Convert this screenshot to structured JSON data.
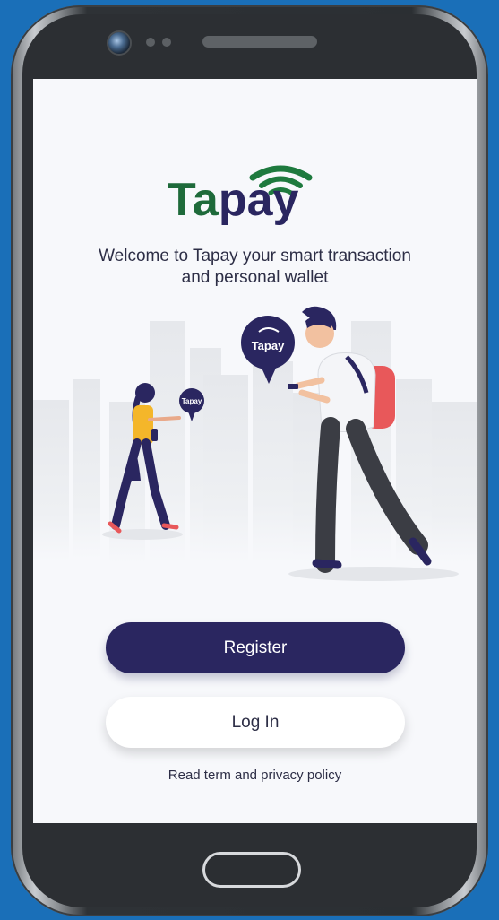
{
  "app": {
    "logo_text": "Tapay",
    "welcome_line1": "Welcome to Tapay your smart transaction",
    "welcome_line2": "and personal wallet",
    "bubble_text": "Tapay"
  },
  "actions": {
    "register_label": "Register",
    "login_label": "Log In",
    "terms_link": "Read term and privacy policy"
  },
  "colors": {
    "brand_green": "#1e6a3a",
    "brand_navy": "#2a2660",
    "background": "#f7f8fb",
    "bag_red": "#e8585a",
    "shirt_yellow": "#f4b62a"
  },
  "icons": [
    "camera-icon",
    "speaker-icon",
    "home-button-icon",
    "wifi-signal-icon"
  ]
}
